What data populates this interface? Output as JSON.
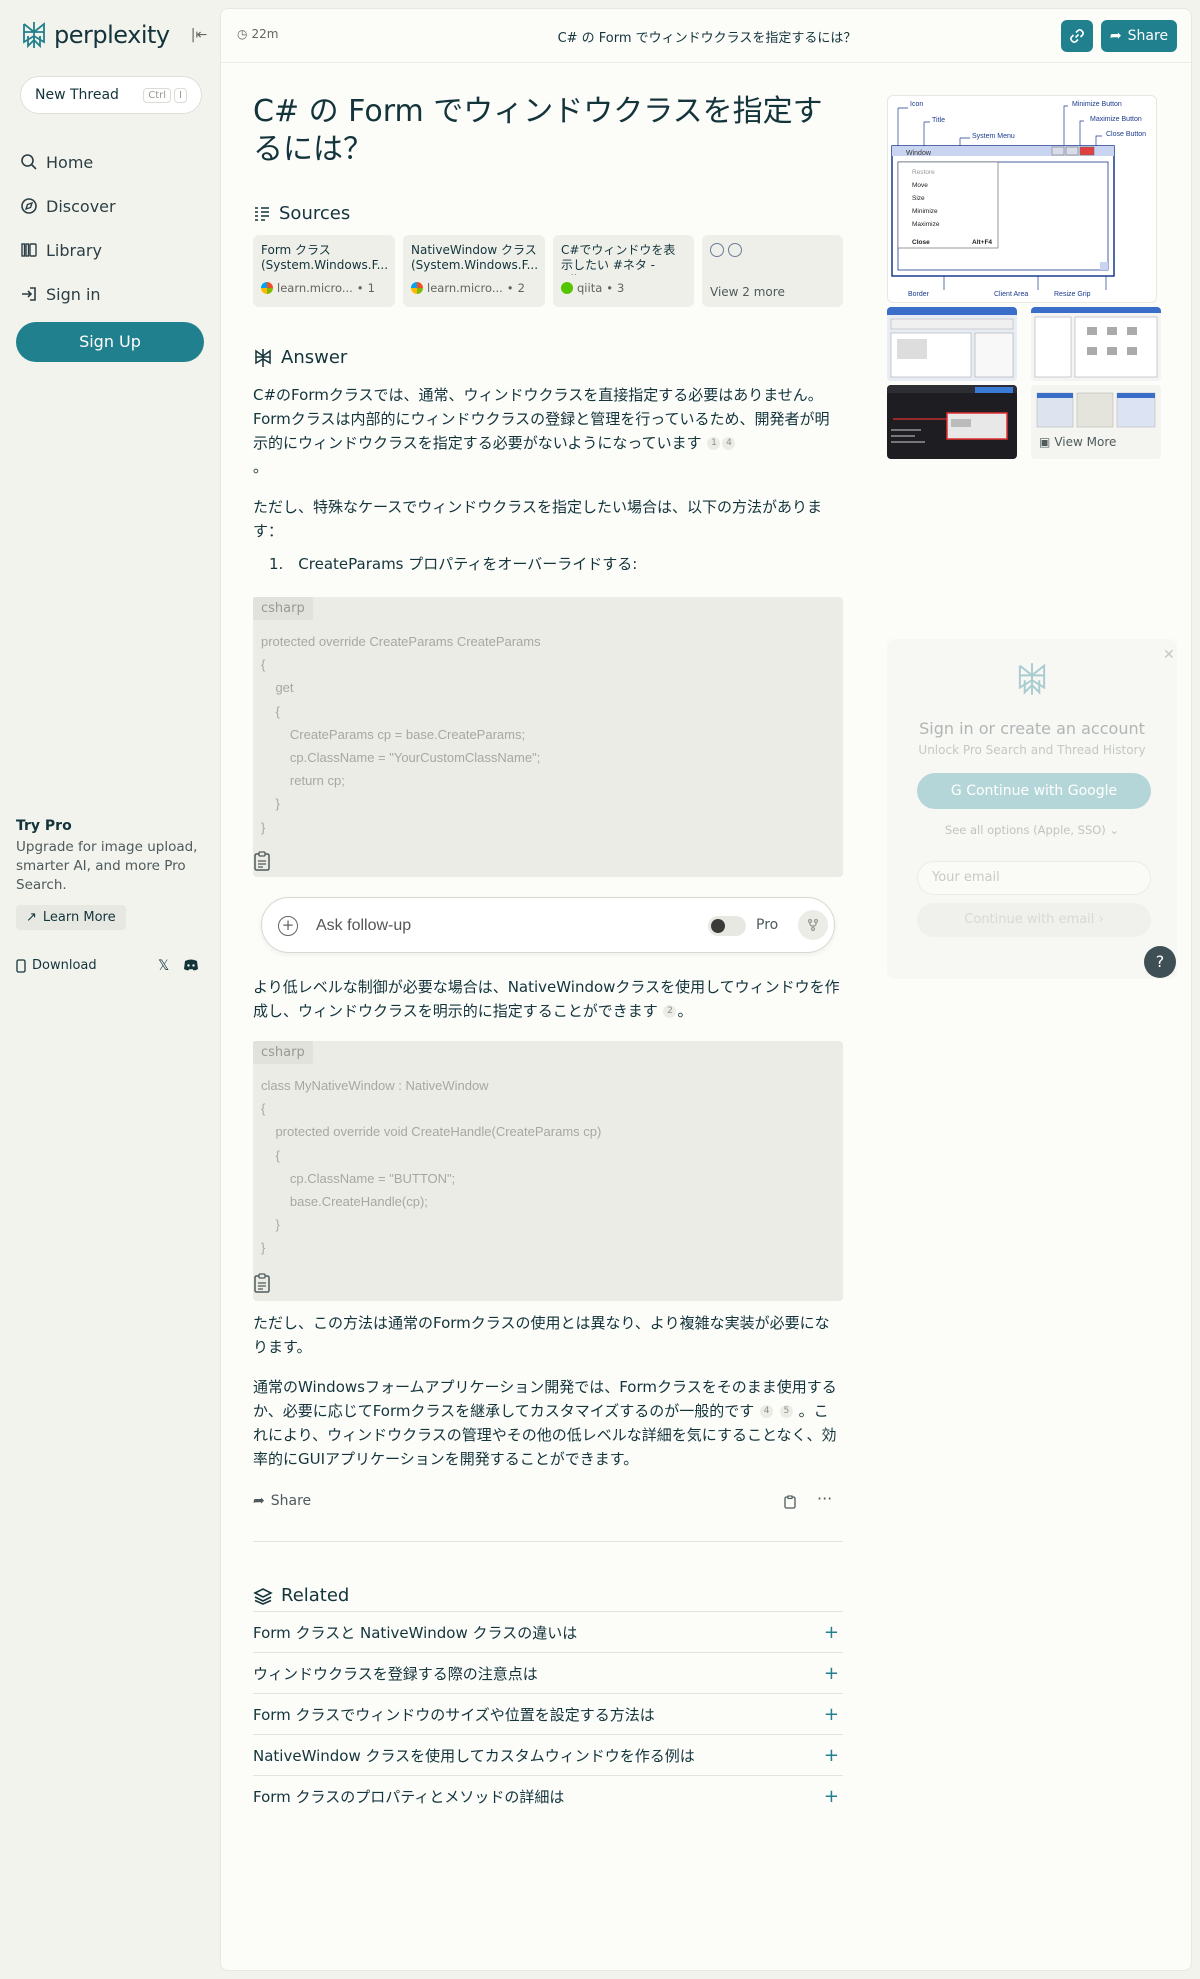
{
  "app": {
    "name": "perplexity"
  },
  "sidebar": {
    "new_thread": "New Thread",
    "shortcut_ctrl": "Ctrl",
    "shortcut_key": "I",
    "nav": [
      {
        "label": "Home",
        "icon": "search-icon"
      },
      {
        "label": "Discover",
        "icon": "compass-icon"
      },
      {
        "label": "Library",
        "icon": "library-icon"
      },
      {
        "label": "Sign in",
        "icon": "sign-in-icon"
      }
    ],
    "signup": "Sign Up",
    "try_pro_title": "Try Pro",
    "try_pro_desc": "Upgrade for image upload, smarter AI, and more Pro Search.",
    "learn_more": "Learn More",
    "download": "Download"
  },
  "topbar": {
    "time": "22m",
    "title": "C# の Form でウィンドウクラスを指定するには？",
    "share": "Share"
  },
  "question": "C# の Form でウィンドウクラスを指定するには？",
  "sources": {
    "heading": "Sources",
    "items": [
      {
        "title": "Form クラス (System.Windows.F...",
        "site": "learn.micro...",
        "num": "1",
        "favicon": "ms"
      },
      {
        "title": "NativeWindow クラス (System.Windows.F...",
        "site": "learn.micro...",
        "num": "2",
        "favicon": "ms"
      },
      {
        "title": "C#でウィンドウを表示したい #ネタ - Qiita",
        "site": "qiita",
        "num": "3",
        "favicon": "qi"
      }
    ],
    "view_more": "View 2 more"
  },
  "answer": {
    "heading": "Answer",
    "p1": "C#のFormクラスでは、通常、ウィンドウクラスを直接指定する必要はありません。Formクラスは内部的にウィンドウクラスの登録と管理を行っているため、開発者が明示的にウィンドウクラスを指定する必要がないようになっています",
    "p1_cites": [
      "1",
      "4"
    ],
    "p1_end": "。",
    "p2": "ただし、特殊なケースでウィンドウクラスを指定したい場合は、以下の方法があります：",
    "list1": "1.　CreateParams プロパティをオーバーライドする:",
    "code1_lang": "csharp",
    "code1": [
      "protected override CreateParams CreateParams",
      "{",
      "    get",
      "    {",
      "        CreateParams cp = base.CreateParams;",
      "        cp.ClassName = \"YourCustomClassName\";",
      "        return cp;",
      "    }",
      "}"
    ],
    "p3": "より低レベルな制御が必要な場合は、NativeWindowクラスを使用してウィンドウを作成し、ウィンドウクラスを明示的に指定することができます",
    "p3_cite": "2",
    "p3_end": "。",
    "code2_lang": "csharp",
    "code2": [
      "class MyNativeWindow : NativeWindow",
      "{",
      "    protected override void CreateHandle(CreateParams cp)",
      "    {",
      "        cp.ClassName = \"BUTTON\";",
      "        base.CreateHandle(cp);",
      "    }",
      "}"
    ],
    "p4": "ただし、この方法は通常のFormクラスの使用とは異なり、より複雑な実装が必要になります。",
    "p5a": "通常のWindowsフォームアプリケーション開発では、Formクラスをそのまま使用するか、必要に応じてFormクラスを継承してカスタマイズするのが一般的です",
    "p5_cite1": "4",
    "p5_cite2": "5",
    "p5b": "。これにより、ウィンドウクラスの管理やその他の低レベルな詳細を気にすることなく、効率的にGUIアプリケーションを開発することができます。",
    "share": "Share"
  },
  "followup": {
    "placeholder": "Ask follow-up",
    "pro": "Pro"
  },
  "related": {
    "heading": "Related",
    "items": [
      "Form クラスと NativeWindow クラスの違いは",
      "ウィンドウクラスを登録する際の注意点は",
      "Form クラスでウィンドウのサイズや位置を設定する方法は",
      "NativeWindow クラスを使用してカスタムウィンドウを作る例は",
      "Form クラスのプロパティとメソッドの詳細は"
    ]
  },
  "images": {
    "diagram_labels": {
      "icon": "Icon",
      "title": "Title",
      "system_menu": "System Menu",
      "minimize": "Minimize Button",
      "maximize": "Maximize Button",
      "close": "Close Button",
      "window": "Window",
      "menu": [
        "Restore",
        "Move",
        "Size",
        "Minimize",
        "Maximize"
      ],
      "close_item": "Close",
      "close_shortcut": "Alt+F4",
      "border": "Border",
      "client": "Client Area",
      "resize": "Resize Grip"
    },
    "view_more": "View More"
  },
  "signin": {
    "title": "Sign in or create an account",
    "subtitle": "Unlock Pro Search and Thread History",
    "google": "Continue with Google",
    "see_all": "See all options (Apple, SSO)",
    "email_placeholder": "Your email",
    "continue_email": "Continue with email",
    "help": "?"
  },
  "colors": {
    "brand": "#20808d",
    "text": "#13343b",
    "bg": "#f3f3ee"
  }
}
